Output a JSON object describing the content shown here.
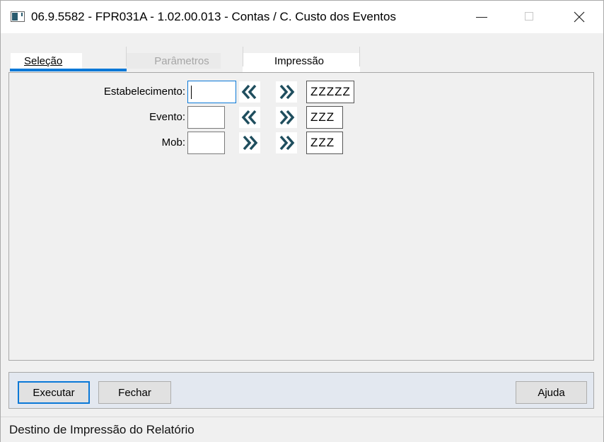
{
  "window": {
    "title": "06.9.5582 - FPR031A - 1.02.00.013 - Contas / C. Custo dos Eventos",
    "icon": "program-window-icon"
  },
  "tabs": [
    {
      "label": "Seleção",
      "selected": true
    },
    {
      "label": "Parâmetros",
      "selected": false,
      "disabled": true
    },
    {
      "label": "Impressão",
      "selected": false
    }
  ],
  "fields": [
    {
      "label": "Estabelecimento:",
      "initial_value": "",
      "final_value": "ZZZZZ",
      "left_arrow": "double-chevron-left-icon",
      "right_arrow": "double-chevron-right-icon"
    },
    {
      "label": "Evento:",
      "initial_value": "",
      "final_value": "ZZZ",
      "left_arrow": "double-chevron-left-icon",
      "right_arrow": "double-chevron-right-icon"
    },
    {
      "label": "Mob:",
      "initial_value": "",
      "final_value": "ZZZ",
      "left_arrow": "double-chevron-right-icon",
      "right_arrow": "double-chevron-right-icon"
    }
  ],
  "buttons": {
    "execute": "Executar",
    "close": "Fechar",
    "help": "Ajuda"
  },
  "status": {
    "text": "Destino de Impressão do Relatório"
  },
  "colors": {
    "accent": "#0a78d7",
    "arrow": "#1f4e5e",
    "button_bar": "#e3e8f0"
  }
}
